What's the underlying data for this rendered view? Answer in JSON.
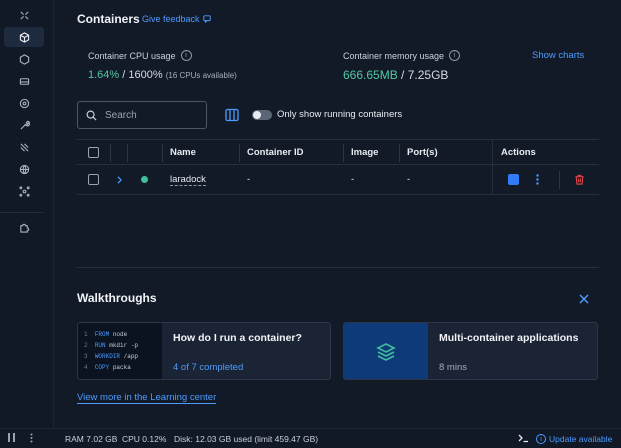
{
  "header": {
    "title": "Containers",
    "feedback": "Give feedback"
  },
  "stats": {
    "cpu": {
      "label": "Container CPU usage",
      "value": "1.64%",
      "total": "/ 1600%",
      "note": "(16 CPUs available)"
    },
    "memory": {
      "label": "Container memory usage",
      "value": "666.65MB",
      "total": "/ 7.25GB"
    },
    "show_charts": "Show charts"
  },
  "toolbar": {
    "search_placeholder": "Search",
    "running_only_label": "Only show running containers"
  },
  "table": {
    "columns": [
      "Name",
      "Container ID",
      "Image",
      "Port(s)",
      "Actions"
    ],
    "rows": [
      {
        "name": "laradock",
        "container_id": "-",
        "image": "-",
        "ports": "-"
      }
    ]
  },
  "walkthroughs": {
    "title": "Walkthroughs",
    "cards": [
      {
        "title": "How do I run a container?",
        "subtitle": "4 of 7 completed",
        "code": [
          {
            "n": "1",
            "kw": "FROM",
            "rest": " node"
          },
          {
            "n": "2",
            "kw": "RUN",
            "rest": " mkdir -p"
          },
          {
            "n": "3",
            "kw": "WORKDIR",
            "rest": " /app"
          },
          {
            "n": "4",
            "kw": "COPY",
            "rest": " packa"
          }
        ]
      },
      {
        "title": "Multi-container applications",
        "subtitle": "8 mins"
      }
    ],
    "learn_link": "View more in the Learning center"
  },
  "statusbar": {
    "ram": "RAM 7.02 GB",
    "cpu": "CPU 0.12%",
    "disk": "Disk: 12.03 GB used (limit 459.47 GB)",
    "update": "Update available"
  },
  "colors": {
    "accent": "#4d9bff",
    "running": "#3fbf9b",
    "delete": "#e5484d",
    "action_blue": "#2f7cf6"
  }
}
